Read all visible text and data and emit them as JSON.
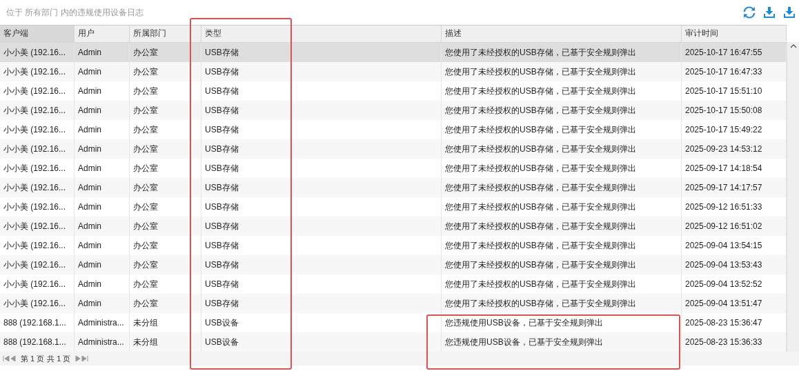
{
  "caption": "位于 所有部门 内的违规使用设备日志",
  "toolbar": [
    {
      "kind": "refresh"
    },
    {
      "kind": "download"
    },
    {
      "kind": "download"
    }
  ],
  "table": {
    "columns": [
      {
        "label": "客户端",
        "sorted": true
      },
      {
        "label": "用户",
        "sorted": false
      },
      {
        "label": "所属部门",
        "sorted": false
      },
      {
        "label": "类型",
        "sorted": false
      },
      {
        "label": "描述",
        "sorted": false
      },
      {
        "label": "审计时间",
        "sorted": false
      }
    ],
    "rows": [
      {
        "selected": true,
        "cells": [
          "小小美 (192.16...",
          "Admin",
          "办公室",
          "USB存储",
          "您使用了未经授权的USB存储，已基于安全规则弹出",
          "2025-10-17 16:47:55"
        ]
      },
      {
        "selected": false,
        "cells": [
          "小小美 (192.16...",
          "Admin",
          "办公室",
          "USB存储",
          "您使用了未经授权的USB存储，已基于安全规则弹出",
          "2025-10-17 16:47:33"
        ]
      },
      {
        "selected": false,
        "cells": [
          "小小美 (192.16...",
          "Admin",
          "办公室",
          "USB存储",
          "您使用了未经授权的USB存储，已基于安全规则弹出",
          "2025-10-17 15:51:10"
        ]
      },
      {
        "selected": false,
        "cells": [
          "小小美 (192.16...",
          "Admin",
          "办公室",
          "USB存储",
          "您使用了未经授权的USB存储，已基于安全规则弹出",
          "2025-10-17 15:50:08"
        ]
      },
      {
        "selected": false,
        "cells": [
          "小小美 (192.16...",
          "Admin",
          "办公室",
          "USB存储",
          "您使用了未经授权的USB存储，已基于安全规则弹出",
          "2025-10-17 15:49:22"
        ]
      },
      {
        "selected": false,
        "cells": [
          "小小美 (192.16...",
          "Admin",
          "办公室",
          "USB存储",
          "您使用了未经授权的USB存储，已基于安全规则弹出",
          "2025-09-23 14:53:12"
        ]
      },
      {
        "selected": false,
        "cells": [
          "小小美 (192.16...",
          "Admin",
          "办公室",
          "USB存储",
          "您使用了未经授权的USB存储，已基于安全规则弹出",
          "2025-09-17 14:18:54"
        ]
      },
      {
        "selected": false,
        "cells": [
          "小小美 (192.16...",
          "Admin",
          "办公室",
          "USB存储",
          "您使用了未经授权的USB存储，已基于安全规则弹出",
          "2025-09-17 14:17:57"
        ]
      },
      {
        "selected": false,
        "cells": [
          "小小美 (192.16...",
          "Admin",
          "办公室",
          "USB存储",
          "您使用了未经授权的USB存储，已基于安全规则弹出",
          "2025-09-12 16:51:33"
        ]
      },
      {
        "selected": false,
        "cells": [
          "小小美 (192.16...",
          "Admin",
          "办公室",
          "USB存储",
          "您使用了未经授权的USB存储，已基于安全规则弹出",
          "2025-09-12 16:51:02"
        ]
      },
      {
        "selected": false,
        "cells": [
          "小小美 (192.16...",
          "Admin",
          "办公室",
          "USB存储",
          "您使用了未经授权的USB存储，已基于安全规则弹出",
          "2025-09-04 13:54:15"
        ]
      },
      {
        "selected": false,
        "cells": [
          "小小美 (192.16...",
          "Admin",
          "办公室",
          "USB存储",
          "您使用了未经授权的USB存储，已基于安全规则弹出",
          "2025-09-04 13:53:43"
        ]
      },
      {
        "selected": false,
        "cells": [
          "小小美 (192.16...",
          "Admin",
          "办公室",
          "USB存储",
          "您使用了未经授权的USB存储，已基于安全规则弹出",
          "2025-09-04 13:52:52"
        ]
      },
      {
        "selected": false,
        "cells": [
          "小小美 (192.16...",
          "Admin",
          "办公室",
          "USB存储",
          "您使用了未经授权的USB存储，已基于安全规则弹出",
          "2025-09-04 13:51:47"
        ]
      },
      {
        "selected": false,
        "cells": [
          "888 (192.168.1...",
          "Administra...",
          "未分组",
          "USB设备",
          "您违规使用USB设备，已基于安全规则弹出",
          "2025-08-23 15:36:47"
        ]
      },
      {
        "selected": false,
        "cells": [
          "888 (192.168.1...",
          "Administra...",
          "未分组",
          "USB设备",
          "您违规使用USB设备，已基于安全规则弹出",
          "2025-08-23 15:36:33"
        ]
      }
    ]
  },
  "pager": {
    "page": "第 1 页",
    "total": "共 1 页"
  }
}
